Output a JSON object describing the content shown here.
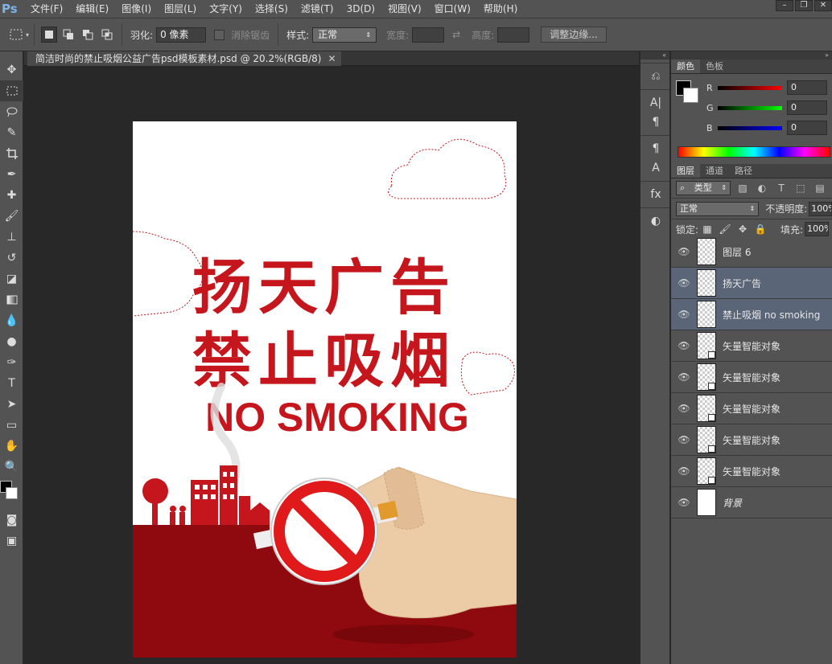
{
  "app": {
    "logo": "Ps"
  },
  "menu": [
    "文件(F)",
    "编辑(E)",
    "图像(I)",
    "图层(L)",
    "文字(Y)",
    "选择(S)",
    "滤镜(T)",
    "3D(D)",
    "视图(V)",
    "窗口(W)",
    "帮助(H)"
  ],
  "options": {
    "feather_label": "羽化:",
    "feather_value": "0 像素",
    "antialias_label": "消除锯齿",
    "style_label": "样式:",
    "style_value": "正常",
    "width_label": "宽度:",
    "height_label": "高度:",
    "refine_button": "调整边缘..."
  },
  "document": {
    "tab_title": "简洁时尚的禁止吸烟公益广告psd模板素材.psd @ 20.2%(RGB/8)",
    "poster": {
      "line1": "扬天广告",
      "line2": "禁止吸烟",
      "line3": "NO SMOKING",
      "accent_color": "#c4161c",
      "dark_red": "#8e0a0e"
    }
  },
  "color_panel": {
    "tabs": [
      "颜色",
      "色板"
    ],
    "r_label": "R",
    "r_value": "0",
    "g_label": "G",
    "g_value": "0",
    "b_label": "B",
    "b_value": "0"
  },
  "layers_panel": {
    "tabs": [
      "图层",
      "通道",
      "路径"
    ],
    "filter_value": "类型",
    "blend_value": "正常",
    "opacity_label": "不透明度:",
    "opacity_value": "100%",
    "lock_label": "锁定:",
    "fill_label": "填充:",
    "fill_value": "100%",
    "layers": [
      {
        "name": "图层 6",
        "selected": false
      },
      {
        "name": "扬天广告",
        "selected": true
      },
      {
        "name": "禁止吸烟 no smoking",
        "selected": true
      },
      {
        "name": "矢量智能对象",
        "selected": false
      },
      {
        "name": "矢量智能对象",
        "selected": false
      },
      {
        "name": "矢量智能对象",
        "selected": false
      },
      {
        "name": "矢量智能对象",
        "selected": false
      },
      {
        "name": "矢量智能对象",
        "selected": false
      },
      {
        "name": "背景",
        "selected": false
      }
    ]
  }
}
